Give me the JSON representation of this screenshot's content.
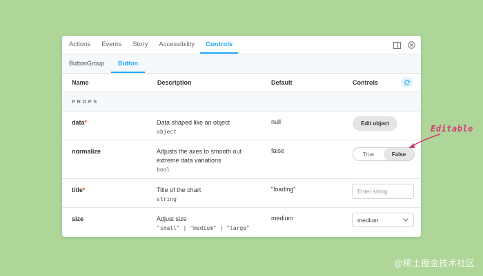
{
  "colors": {
    "accent": "#1ea7fd",
    "background": "#aed698",
    "required": "#ff4400",
    "annotation": "#d9367a"
  },
  "tabs": [
    {
      "label": "Actions",
      "active": false
    },
    {
      "label": "Events",
      "active": false
    },
    {
      "label": "Story",
      "active": false
    },
    {
      "label": "Accessibility",
      "active": false
    },
    {
      "label": "Controls",
      "active": true
    }
  ],
  "tab_icons": [
    "panel-orientation-icon",
    "close-circle-icon"
  ],
  "subtabs": [
    {
      "label": "ButtonGroup",
      "active": false
    },
    {
      "label": "Button",
      "active": true
    }
  ],
  "table": {
    "headers": {
      "name": "Name",
      "description": "Description",
      "default": "Default",
      "controls": "Controls"
    },
    "reset_icon": "refresh-icon",
    "section": "PROPS",
    "rows": [
      {
        "name": "data",
        "required": "*",
        "description": "Data shaped like an object",
        "type": "object",
        "default": "null",
        "control": {
          "kind": "button",
          "label": "Edit object"
        }
      },
      {
        "name": "normalize",
        "required": "",
        "description": "Adjusts the axes to smooth out extreme data variations",
        "type": "bool",
        "default": "false",
        "control": {
          "kind": "toggle",
          "options": [
            "True",
            "False"
          ],
          "selected": "False"
        }
      },
      {
        "name": "title",
        "required": "*",
        "description": "Title of the chart",
        "type": "string",
        "default": "\"loading\"",
        "control": {
          "kind": "text",
          "placeholder": "Enter string",
          "value": ""
        }
      },
      {
        "name": "size",
        "required": "",
        "description": "Adjust size",
        "type": "\"small\" | \"medium\" | \"large\"",
        "default": "medium",
        "control": {
          "kind": "select",
          "value": "medium"
        }
      }
    ]
  },
  "annotation": {
    "text": "Editable"
  },
  "watermark": {
    "text": "@稀土掘金技术社区"
  }
}
